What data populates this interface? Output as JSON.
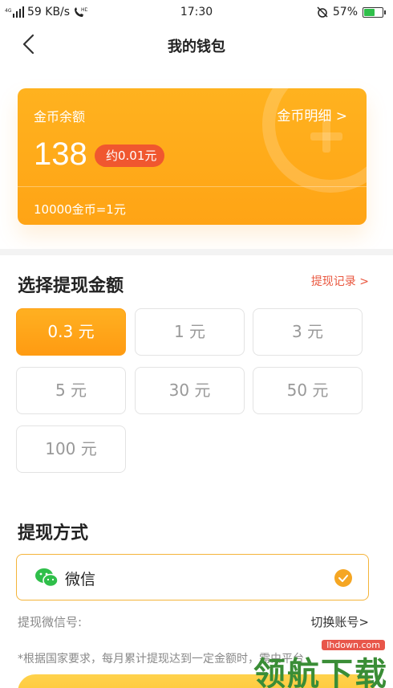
{
  "status_bar": {
    "network": "4G",
    "speed": "59 KB/s",
    "hd": "HD",
    "time": "17:30",
    "battery": "57%",
    "battery_level": 0.57
  },
  "nav": {
    "title": "我的钱包"
  },
  "coin_card": {
    "balance_label": "金币余额",
    "detail_link": "金币明细 >",
    "balance": "138",
    "approx": "约0.01元",
    "rate": "10000金币=1元"
  },
  "withdraw": {
    "title": "选择提现金额",
    "records_link": "提现记录 >",
    "amounts": [
      "0.3 元",
      "1 元",
      "3 元",
      "5 元",
      "30 元",
      "50 元",
      "100 元"
    ],
    "selected_index": 0
  },
  "method": {
    "title": "提现方式",
    "option": "微信",
    "account_label": "提现微信号:",
    "switch_link": "切换账号>",
    "notice": "*根据国家要求，每月累计提现达到一定金额时，需由平台"
  },
  "watermark": {
    "text": "领航下载",
    "url": "lhdown.com"
  },
  "colors": {
    "accent": "#ffa415",
    "badge": "#f0572f",
    "link_red": "#e9573f",
    "wechat_green": "#2fbf4a"
  }
}
